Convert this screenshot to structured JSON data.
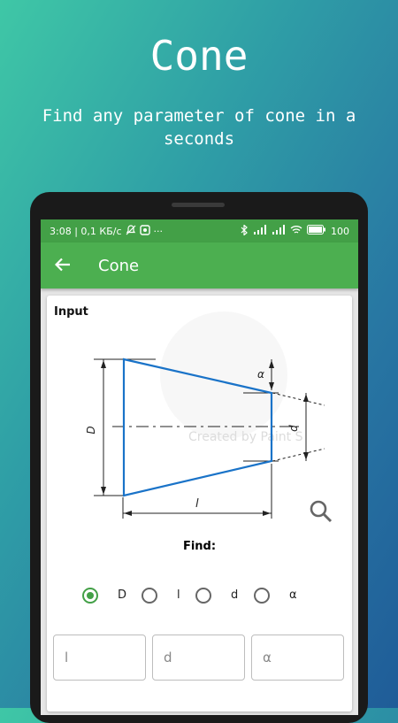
{
  "promo": {
    "title": "Cone",
    "subtitle": "Find any parameter of cone in a seconds"
  },
  "status_bar": {
    "left": "3:08 | 0,1 КБ/с",
    "more": "···",
    "battery": "100"
  },
  "app_bar": {
    "title": "Cone"
  },
  "card": {
    "input_label": "Input",
    "watermark": "Created by Paint S",
    "diagram_labels": {
      "D": "D",
      "l": "l",
      "d": "d",
      "alpha": "α"
    },
    "find_label": "Find:",
    "options": [
      {
        "label": "D",
        "selected": true
      },
      {
        "label": "l",
        "selected": false
      },
      {
        "label": "d",
        "selected": false
      },
      {
        "label": "α",
        "selected": false
      }
    ],
    "fields": [
      {
        "placeholder": "l"
      },
      {
        "placeholder": "d"
      },
      {
        "placeholder": "α"
      }
    ]
  },
  "colors": {
    "accent": "#4caf50",
    "status_bar": "#43a047",
    "cone_line": "#1a73c8"
  }
}
